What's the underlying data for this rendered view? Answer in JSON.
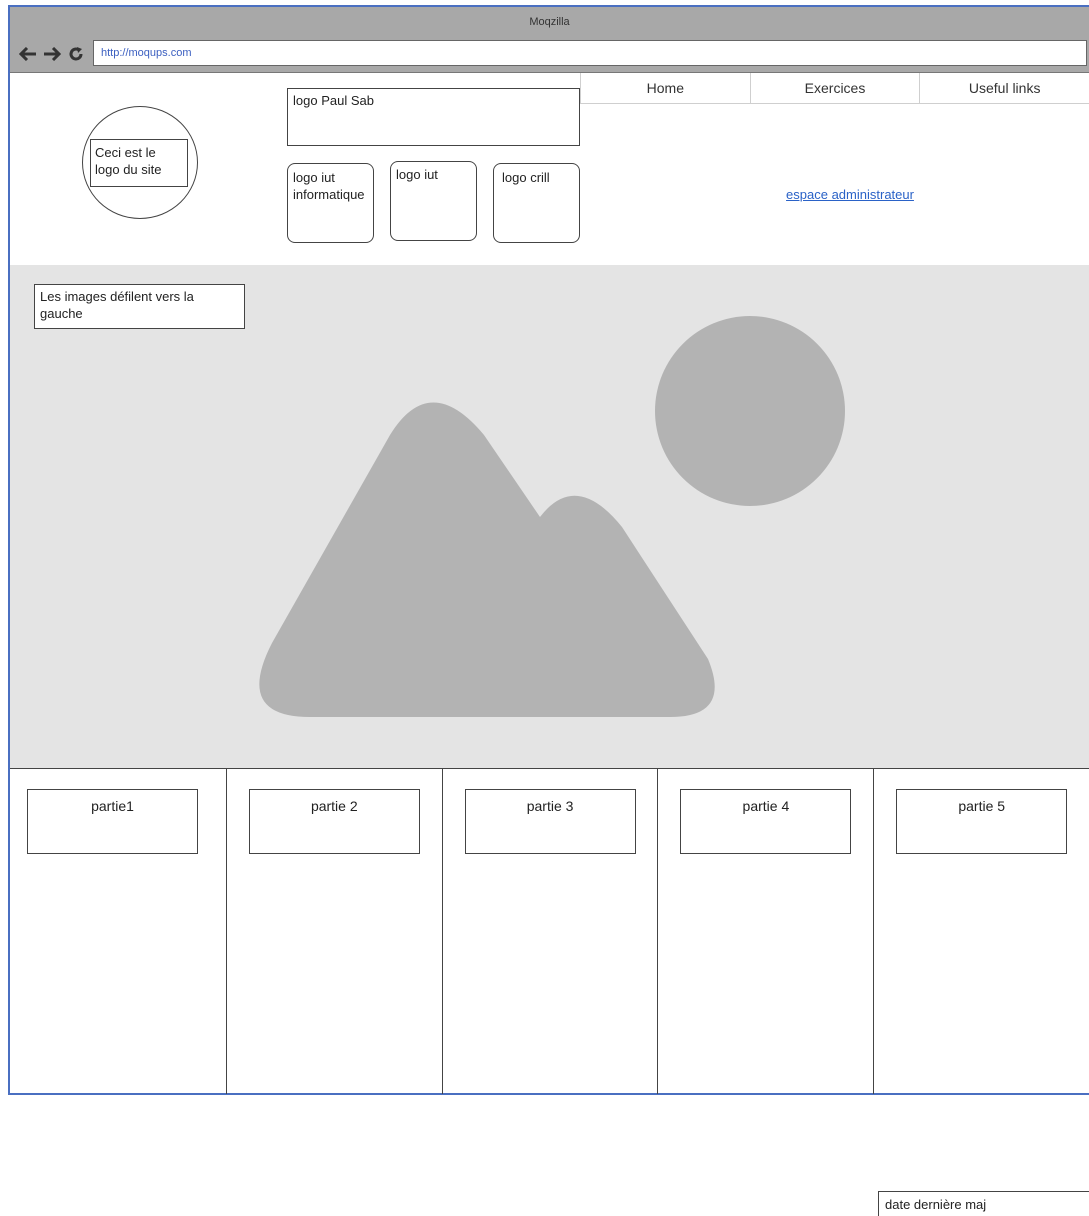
{
  "browser": {
    "title": "Moqzilla",
    "url": "http://moqups.com",
    "nav_icons": [
      "back-arrow-icon",
      "forward-arrow-icon",
      "reload-icon"
    ]
  },
  "header": {
    "site_logo": "Ceci est le logo du site",
    "logo_paul_sab": "logo Paul Sab",
    "logos": [
      "logo iut informatique",
      "logo iut",
      "logo crill"
    ],
    "nav_tabs": [
      "Home",
      "Exercices",
      "Useful links"
    ],
    "admin_link": "espace administrateur"
  },
  "carousel": {
    "note": "Les images défilent vers la gauche",
    "image_icon": "image-placeholder-icon"
  },
  "parts": [
    "partie1",
    "partie 2",
    "partie 3",
    "partie 4",
    "partie 5"
  ],
  "footer": {
    "last_update_label": "date dernière maj"
  },
  "colors": {
    "frame_border": "#4a6fc1",
    "chrome": "#a8a8a8",
    "carousel_bg": "#e4e4e4",
    "placeholder": "#b3b3b3",
    "link": "#2a62c7"
  }
}
